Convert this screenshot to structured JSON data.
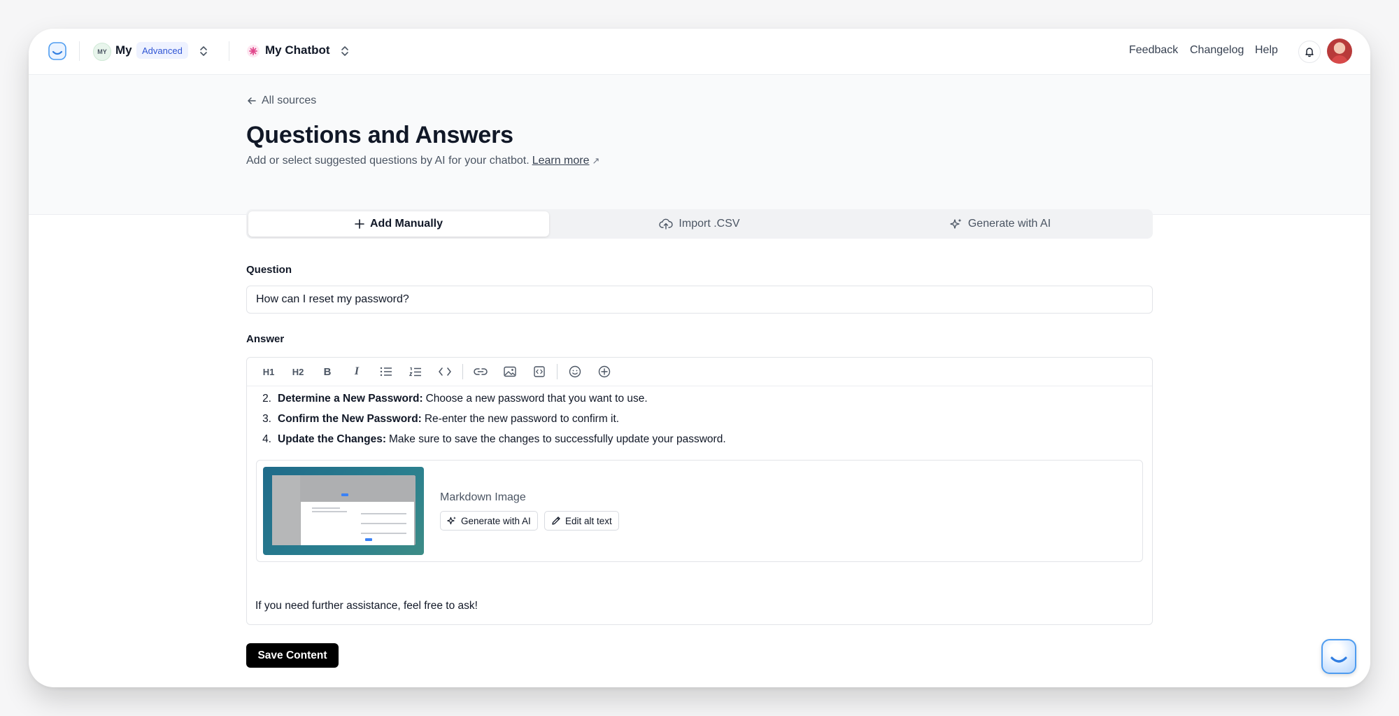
{
  "topbar": {
    "workspace_initials": "MY",
    "workspace_name": "My",
    "plan_badge": "Advanced",
    "chatbot_name": "My Chatbot",
    "links": {
      "feedback": "Feedback",
      "changelog": "Changelog",
      "help": "Help"
    }
  },
  "header": {
    "back_label": "All sources",
    "title": "Questions and Answers",
    "subtitle": "Add or select suggested questions by AI for your chatbot.",
    "learn_more": "Learn more"
  },
  "tabs": [
    {
      "label": "Add Manually",
      "active": true
    },
    {
      "label": "Import .CSV",
      "active": false
    },
    {
      "label": "Generate with AI",
      "active": false
    }
  ],
  "form": {
    "question_label": "Question",
    "question_value": "How can I reset my password?",
    "answer_label": "Answer"
  },
  "editor": {
    "toolbar": {
      "h1": "H1",
      "h2": "H2",
      "bold": "B",
      "italic": "I"
    },
    "list_items": [
      {
        "num": "2.",
        "bold": "Determine a New Password:",
        "text": "Choose a new password that you want to use."
      },
      {
        "num": "3.",
        "bold": "Confirm the New Password:",
        "text": "Re-enter the new password to confirm it."
      },
      {
        "num": "4.",
        "bold": "Update the Changes:",
        "text": "Make sure to save the changes to successfully update your password."
      }
    ],
    "image_card": {
      "title": "Markdown Image",
      "generate_label": "Generate with AI",
      "edit_alt_label": "Edit alt text"
    },
    "closing_text": "If you need further assistance, feel free to ask!"
  },
  "actions": {
    "save_label": "Save Content"
  },
  "colors": {
    "accent_blue": "#2f55d4",
    "primary_button": "#000000",
    "badge_bg": "#eef2ff"
  }
}
